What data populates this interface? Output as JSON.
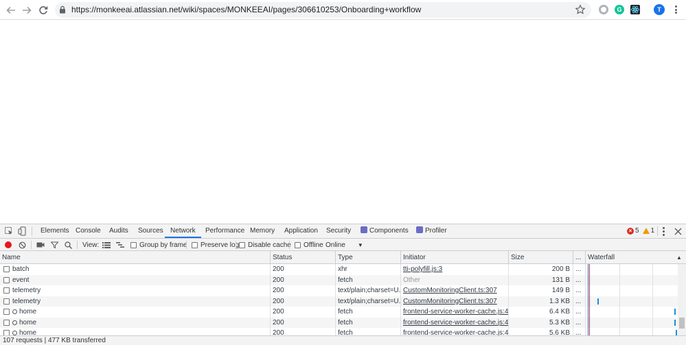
{
  "browser": {
    "url": "https://monkeeai.atlassian.net/wiki/spaces/MONKEEAI/pages/306610253/Onboarding+workflow",
    "profile_initial": "T",
    "extension_grammarly_letter": "G"
  },
  "devtools": {
    "tabs": [
      "Elements",
      "Console",
      "Audits",
      "Sources",
      "Network",
      "Performance",
      "Memory",
      "Application",
      "Security",
      "Components",
      "Profiler"
    ],
    "active_tab": "Network",
    "errors_count": "5",
    "warnings_count": "1",
    "toolbar": {
      "view_label": "View:",
      "group_by_frame": "Group by frame",
      "preserve_log": "Preserve log",
      "disable_cache": "Disable cache",
      "offline": "Offline",
      "throttle": "Online"
    },
    "columns": {
      "name": "Name",
      "status": "Status",
      "type": "Type",
      "initiator": "Initiator",
      "size": "Size",
      "more": "...",
      "waterfall": "Waterfall"
    },
    "rows": [
      {
        "name": "batch",
        "status": "200",
        "type": "xhr",
        "initiator": "tti-polyfill.js:3",
        "initiator_link": true,
        "size": "200 B",
        "sw": false
      },
      {
        "name": "event",
        "status": "200",
        "type": "fetch",
        "initiator": "Other",
        "initiator_link": false,
        "size": "131 B",
        "sw": false
      },
      {
        "name": "telemetry",
        "status": "200",
        "type": "text/plain;charset=U...",
        "initiator": "CustomMonitoringClient.ts:307",
        "initiator_link": true,
        "size": "149 B",
        "sw": false
      },
      {
        "name": "telemetry",
        "status": "200",
        "type": "text/plain;charset=U...",
        "initiator": "CustomMonitoringClient.ts:307",
        "initiator_link": true,
        "size": "1.3 KB",
        "sw": false
      },
      {
        "name": "home",
        "status": "200",
        "type": "fetch",
        "initiator": "frontend-service-worker-cache.js:4",
        "initiator_link": true,
        "size": "6.4 KB",
        "sw": true
      },
      {
        "name": "home",
        "status": "200",
        "type": "fetch",
        "initiator": "frontend-service-worker-cache.js:4",
        "initiator_link": true,
        "size": "5.3 KB",
        "sw": true
      },
      {
        "name": "home",
        "status": "200",
        "type": "fetch",
        "initiator": "frontend-service-worker-cache.js:4",
        "initiator_link": true,
        "size": "5.6 KB",
        "sw": true
      }
    ],
    "row_more": "...",
    "summary": "107 requests  |  477 KB transferred"
  },
  "colors": {
    "accent": "#1a73e8",
    "error": "#d93025",
    "warning": "#f29900",
    "record": "#e8171c",
    "waterfall_bar": "#1a8fd8"
  }
}
